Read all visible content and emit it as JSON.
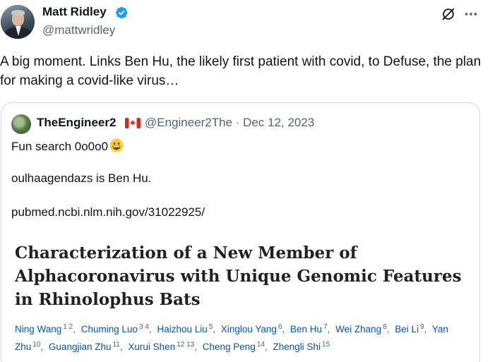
{
  "tweet": {
    "author_name": "Matt Ridley",
    "author_handle": "@mattwridley",
    "text": "A big moment. Links Ben Hu, the likely first patient with covid, to Defuse, the plan for making a covid-like virus…"
  },
  "quote": {
    "author_name": "TheEngineer2",
    "author_handle_date": "@Engineer2The · Dec 12, 2023",
    "line1": "Fun search 0o0o0",
    "line2": "oulhaagendazs is Ben Hu.",
    "line3": "pubmed.ncbi.nlm.nih.gov/31022925/",
    "paper": {
      "title": "Characterization of a New Member of Alphacoronavirus with Unique Genomic Features in Rhinolophus Bats",
      "authors": [
        {
          "name": "Ning Wang",
          "sup": "1 2"
        },
        {
          "name": "Chuming Luo",
          "sup": "3 4"
        },
        {
          "name": "Haizhou Liu",
          "sup": "5"
        },
        {
          "name": "Xinglou Yang",
          "sup": "6"
        },
        {
          "name": "Ben Hu",
          "sup": "7"
        },
        {
          "name": "Wei Zhang",
          "sup": "8"
        },
        {
          "name": "Bei Li",
          "sup": "9"
        },
        {
          "name": "Yan Zhu",
          "sup": "10"
        },
        {
          "name": "Guangjian Zhu",
          "sup": "11"
        },
        {
          "name": "Xurui Shen",
          "sup": "12 13"
        },
        {
          "name": "Cheng Peng",
          "sup": "14"
        },
        {
          "name": "Zhengli Shi",
          "sup": "15"
        }
      ]
    }
  },
  "icons": {
    "verified": "verified-badge-icon",
    "grok": "grok-icon",
    "more": "more-options-icon",
    "flag": "canada-flag-icon",
    "emoji": "grinning-face-emoji"
  },
  "colors": {
    "text_primary": "#0f1419",
    "text_secondary": "#536471",
    "verified_blue": "#1d9bf0",
    "border": "#cfd9de",
    "author_link": "#0656ad"
  }
}
